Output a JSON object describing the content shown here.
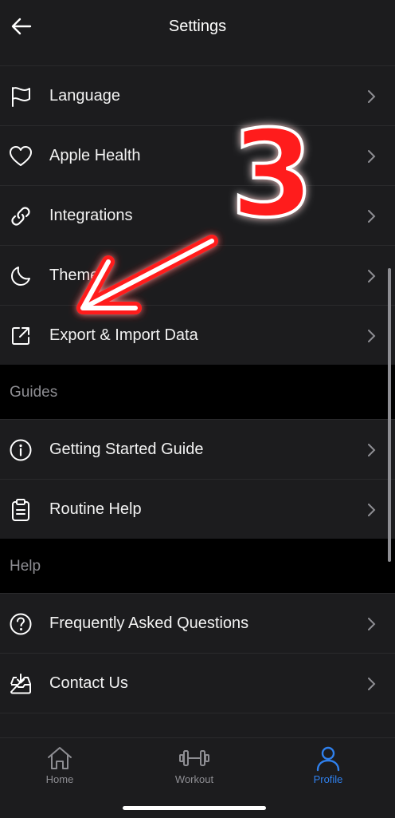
{
  "header": {
    "title": "Settings"
  },
  "settings_items": [
    {
      "label": "Language",
      "icon": "flag-icon"
    },
    {
      "label": "Apple Health",
      "icon": "heart-icon"
    },
    {
      "label": "Integrations",
      "icon": "link-icon"
    },
    {
      "label": "Theme",
      "icon": "moon-icon"
    },
    {
      "label": "Export & Import Data",
      "icon": "export-icon"
    }
  ],
  "guides": {
    "title": "Guides",
    "items": [
      {
        "label": "Getting Started Guide",
        "icon": "info-icon"
      },
      {
        "label": "Routine Help",
        "icon": "clipboard-icon"
      }
    ]
  },
  "help": {
    "title": "Help",
    "items": [
      {
        "label": "Frequently Asked Questions",
        "icon": "question-icon"
      },
      {
        "label": "Contact Us",
        "icon": "inbox-icon"
      }
    ]
  },
  "annotation": {
    "number": "3",
    "color": "#ff2020"
  },
  "tabs": [
    {
      "label": "Home",
      "icon": "home-icon",
      "active": false
    },
    {
      "label": "Workout",
      "icon": "dumbbell-icon",
      "active": false
    },
    {
      "label": "Profile",
      "icon": "person-icon",
      "active": true
    }
  ],
  "colors": {
    "accent": "#2f80ed",
    "inactive": "#8e8e93",
    "background": "#000000",
    "row": "#1c1c1e"
  }
}
